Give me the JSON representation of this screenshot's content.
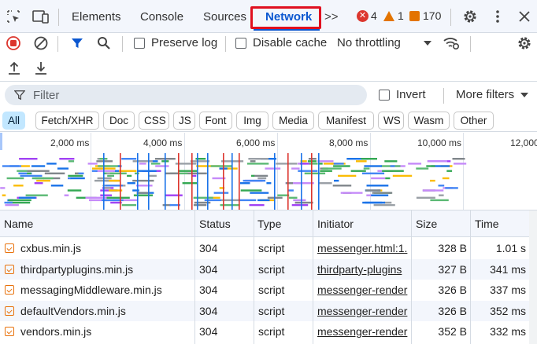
{
  "tabs": {
    "elements": "Elements",
    "console": "Console",
    "sources": "Sources",
    "network": "Network",
    "more": ">>"
  },
  "badges": {
    "errors": "4",
    "warnings": "1",
    "issues": "170"
  },
  "colors": {
    "accent": "#0b57d0",
    "error": "#dc362e",
    "warning": "#e37400",
    "highlight": "#e0101f"
  },
  "toolbar": {
    "preserve_log": "Preserve log",
    "disable_cache": "Disable cache",
    "throttling": "No throttling"
  },
  "filter": {
    "placeholder": "Filter",
    "invert": "Invert",
    "more_filters": "More filters"
  },
  "chips": [
    "All",
    "Fetch/XHR",
    "Doc",
    "CSS",
    "JS",
    "Font",
    "Img",
    "Media",
    "Manifest",
    "WS",
    "Wasm",
    "Other"
  ],
  "timeline": {
    "ticks": [
      "2,000 ms",
      "4,000 ms",
      "6,000 ms",
      "8,000 ms",
      "10,000 ms",
      "12,000"
    ]
  },
  "table": {
    "headers": [
      "Name",
      "Status",
      "Type",
      "Initiator",
      "Size",
      "Time"
    ],
    "rows": [
      {
        "name": "cxbus.min.js",
        "status": "304",
        "type": "script",
        "initiator": "messenger.html:1.",
        "size": "328 B",
        "time": "1.01 s"
      },
      {
        "name": "thirdpartyplugins.min.js",
        "status": "304",
        "type": "script",
        "initiator": "thirdparty-plugins",
        "size": "327 B",
        "time": "341 ms"
      },
      {
        "name": "messagingMiddleware.min.js",
        "status": "304",
        "type": "script",
        "initiator": "messenger-render",
        "size": "326 B",
        "time": "337 ms"
      },
      {
        "name": "defaultVendors.min.js",
        "status": "304",
        "type": "script",
        "initiator": "messenger-render",
        "size": "326 B",
        "time": "352 ms"
      },
      {
        "name": "vendors.min.js",
        "status": "304",
        "type": "script",
        "initiator": "messenger-render",
        "size": "352 B",
        "time": "332 ms"
      }
    ]
  }
}
